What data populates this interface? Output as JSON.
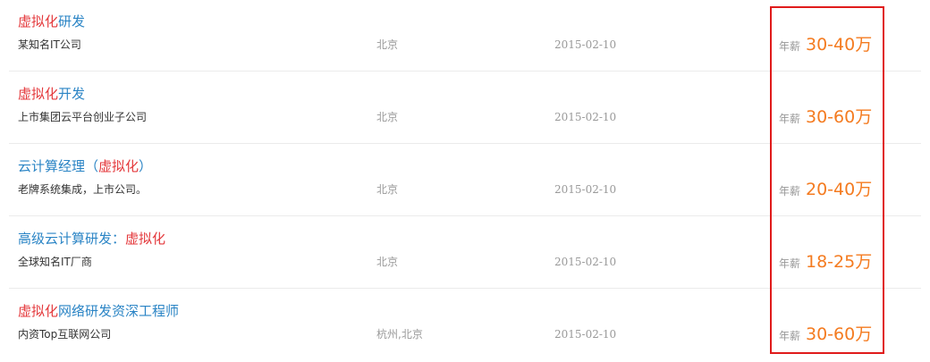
{
  "jobs": [
    {
      "title_segments": [
        {
          "text": "虚拟化",
          "highlight": true
        },
        {
          "text": "研发",
          "highlight": false
        }
      ],
      "company": "某知名IT公司",
      "location": "北京",
      "date": "2015-02-10",
      "salary_label": "年薪",
      "salary": "30-40万"
    },
    {
      "title_segments": [
        {
          "text": "虚拟化",
          "highlight": true
        },
        {
          "text": "开发",
          "highlight": false
        }
      ],
      "company": "上市集团云平台创业子公司",
      "location": "北京",
      "date": "2015-02-10",
      "salary_label": "年薪",
      "salary": "30-60万"
    },
    {
      "title_segments": [
        {
          "text": "云计算经理（",
          "highlight": false
        },
        {
          "text": "虚拟化",
          "highlight": true
        },
        {
          "text": "）",
          "highlight": false
        }
      ],
      "company": "老牌系统集成，上市公司。",
      "location": "北京",
      "date": "2015-02-10",
      "salary_label": "年薪",
      "salary": "20-40万"
    },
    {
      "title_segments": [
        {
          "text": "高级云计算研发：",
          "highlight": false
        },
        {
          "text": "虚拟化",
          "highlight": true
        }
      ],
      "company": "全球知名IT厂商",
      "location": "北京",
      "date": "2015-02-10",
      "salary_label": "年薪",
      "salary": "18-25万"
    },
    {
      "title_segments": [
        {
          "text": "虚拟化",
          "highlight": true
        },
        {
          "text": "网络研发资深工程师",
          "highlight": false
        }
      ],
      "company": "内资Top互联网公司",
      "location": "杭州,北京",
      "date": "2015-02-10",
      "salary_label": "年薪",
      "salary": "30-60万"
    }
  ],
  "colors": {
    "title_link": "#2a84c5",
    "keyword_highlight": "#e4393c",
    "salary": "#f47b20",
    "muted_text": "#999999",
    "highlight_box_border": "#e01b1b"
  }
}
